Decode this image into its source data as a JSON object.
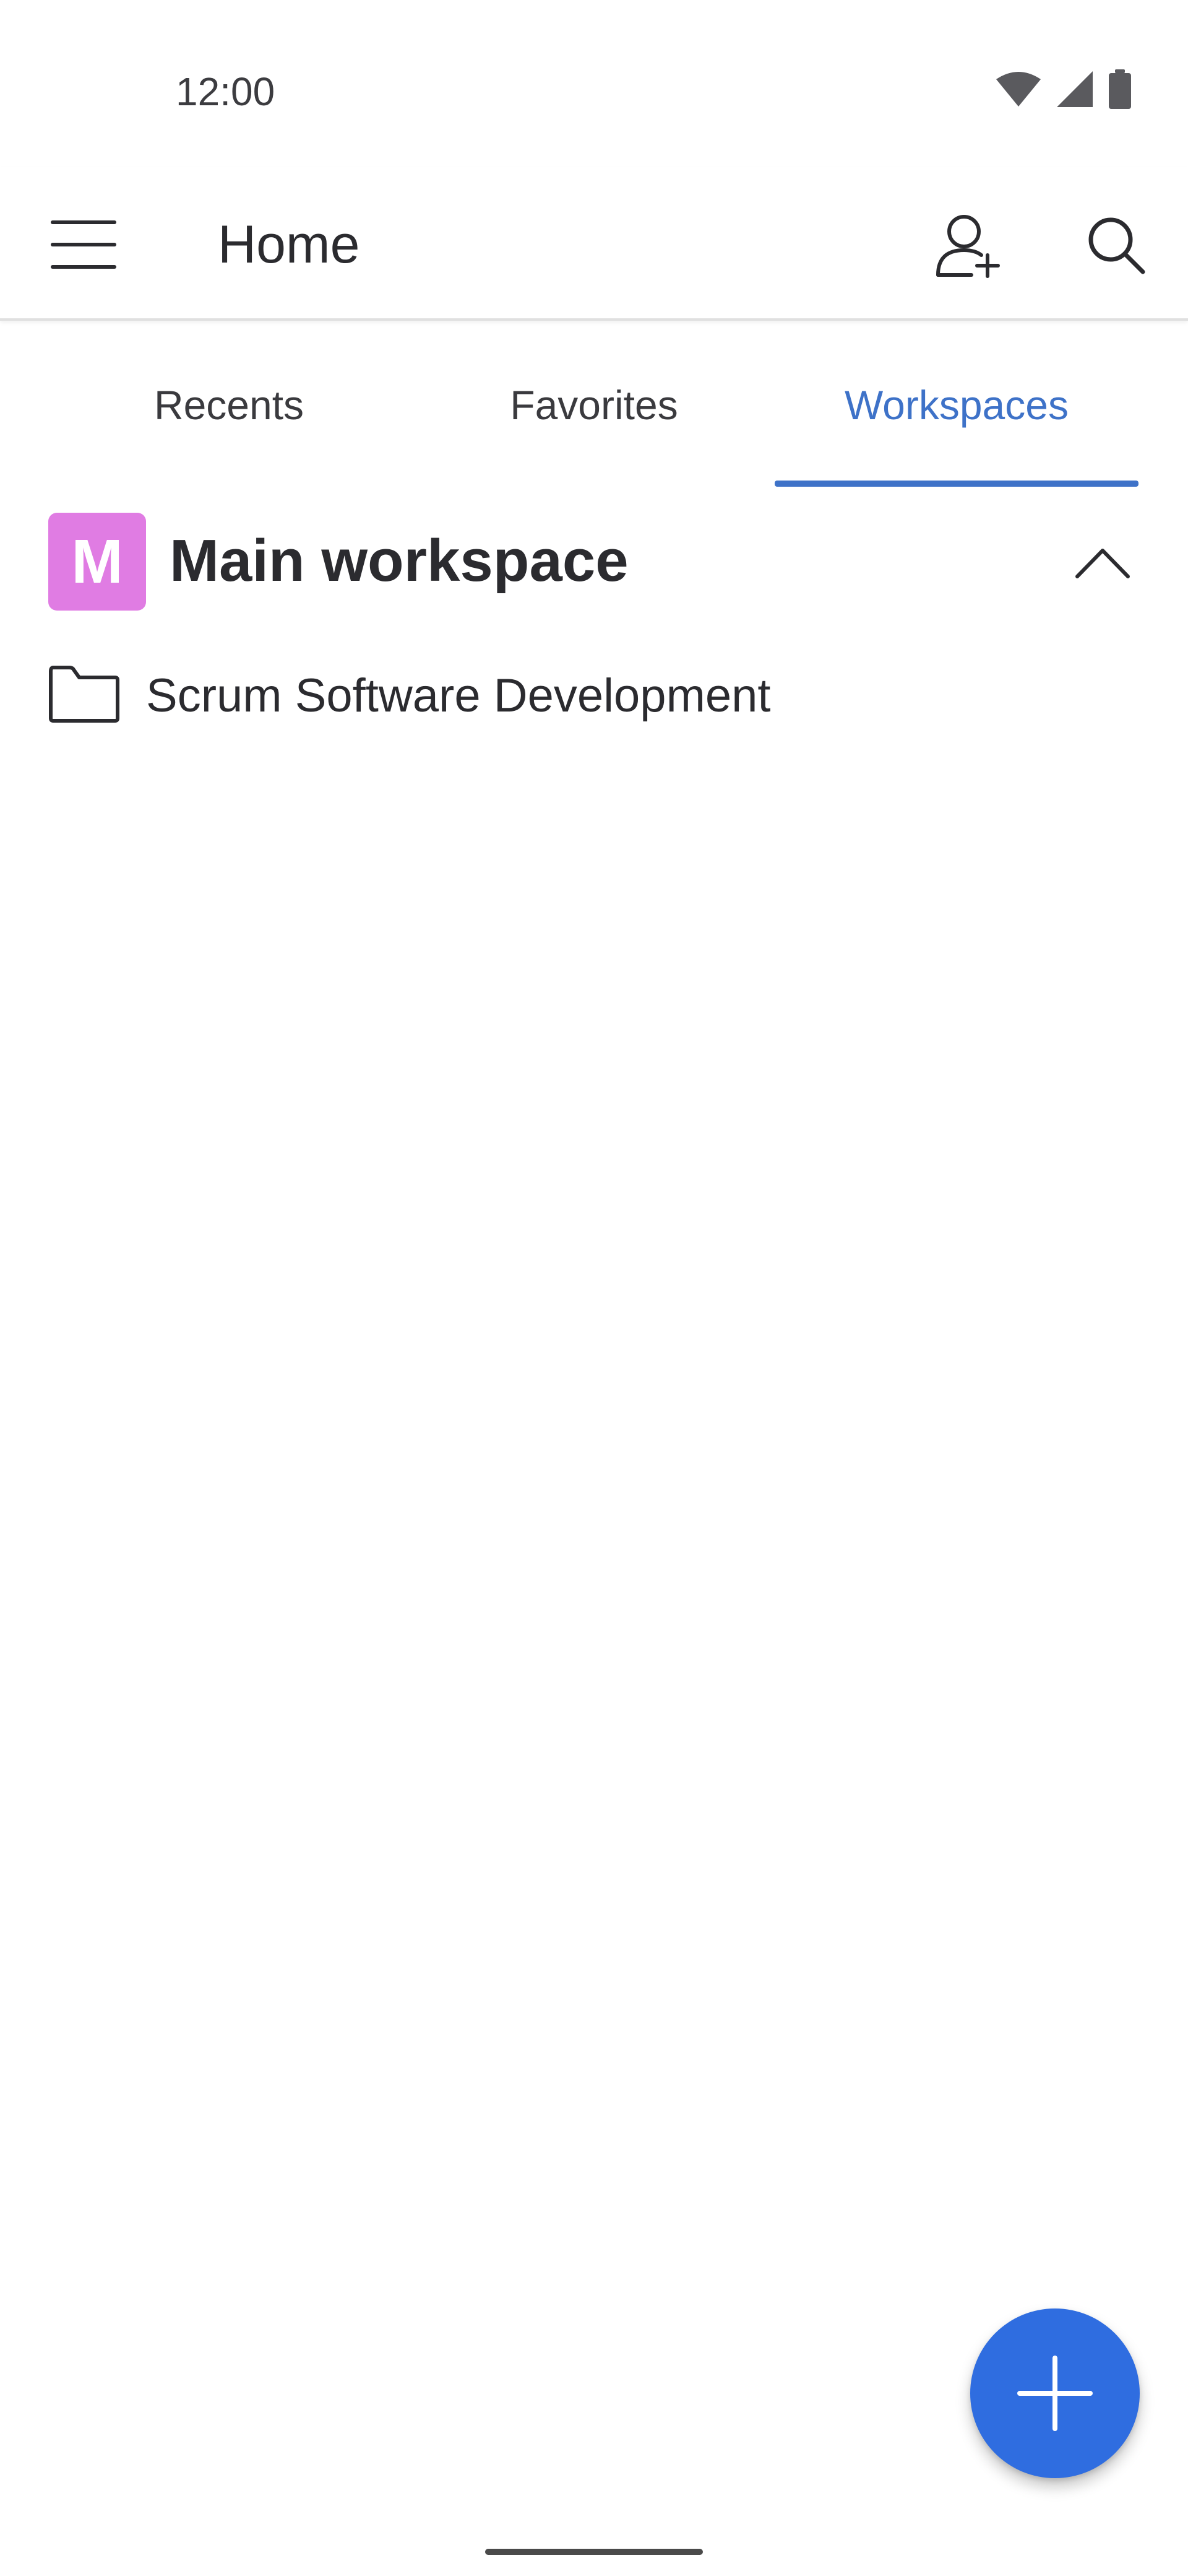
{
  "status_bar": {
    "time": "12:00",
    "icons": [
      "wifi-icon",
      "signal-icon",
      "battery-icon"
    ]
  },
  "app_bar": {
    "title": "Home",
    "icons": {
      "menu": "menu-icon",
      "add_user": "add-user-icon",
      "search": "search-icon"
    }
  },
  "tabs": [
    {
      "label": "Recents",
      "selected": false
    },
    {
      "label": "Favorites",
      "selected": false
    },
    {
      "label": "Workspaces",
      "selected": true
    }
  ],
  "workspace": {
    "avatar_letter": "M",
    "title": "Main workspace",
    "expanded": true,
    "items": [
      {
        "label": "Scrum Software Development",
        "icon": "folder-icon"
      }
    ]
  },
  "fab": {
    "icon": "plus-icon"
  },
  "colors": {
    "accent": "#3e72c8",
    "fab": "#2f6de0",
    "avatar": "#e07ce3",
    "text": "#2b2b2f"
  }
}
